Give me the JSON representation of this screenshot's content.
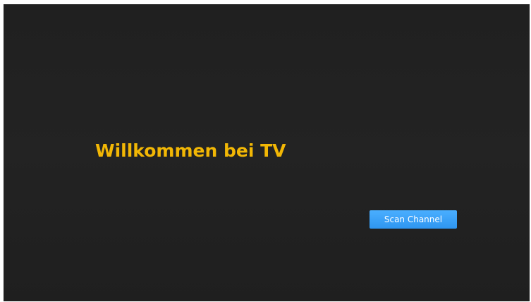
{
  "screen": {
    "welcome_text": "Willkommen bei TV",
    "scan_button_label": "Scan Channel"
  },
  "colors": {
    "background": "#222222",
    "welcome_text": "#f2b705",
    "button": "#3aa2f7",
    "button_text": "#ffffff"
  }
}
